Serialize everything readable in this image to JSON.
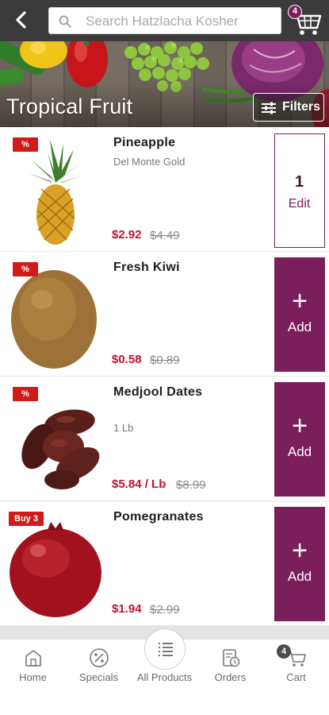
{
  "header": {
    "search_placeholder": "Search Hatzlacha Kosher",
    "cart_count": "4"
  },
  "banner": {
    "title": "Tropical Fruit",
    "filters_label": "Filters"
  },
  "products": [
    {
      "name": "Pineapple",
      "subtitle": "Del Monte Gold",
      "promo": "%",
      "price": "$2.92",
      "old_price": "$4.49",
      "button_state": "edit",
      "qty": "1",
      "button_label": "Edit"
    },
    {
      "name": "Fresh Kiwi",
      "subtitle": "",
      "promo": "%",
      "price": "$0.58",
      "old_price": "$0.89",
      "button_state": "add",
      "button_label": "Add"
    },
    {
      "name": "Medjool Dates",
      "subtitle": "1 Lb",
      "promo": "%",
      "price": "$5.84 / Lb",
      "old_price": "$8.99",
      "button_state": "add",
      "button_label": "Add"
    },
    {
      "name": "Pomegranates",
      "subtitle": "",
      "promo": "Buy 3",
      "price": "$1.94",
      "old_price": "$2.99",
      "button_state": "add",
      "button_label": "Add"
    }
  ],
  "bottom_nav": {
    "items": [
      {
        "label": "Home",
        "icon": "home-icon"
      },
      {
        "label": "Specials",
        "icon": "specials-icon"
      },
      {
        "label": "All Products",
        "icon": "list-icon"
      },
      {
        "label": "Orders",
        "icon": "orders-icon"
      },
      {
        "label": "Cart",
        "icon": "cart-icon"
      }
    ],
    "cart_badge": "4"
  },
  "colors": {
    "accent": "#7a1f5c",
    "price_red": "#c8102e",
    "promo_red": "#d11a1a",
    "topbar": "#3b3b3b"
  }
}
